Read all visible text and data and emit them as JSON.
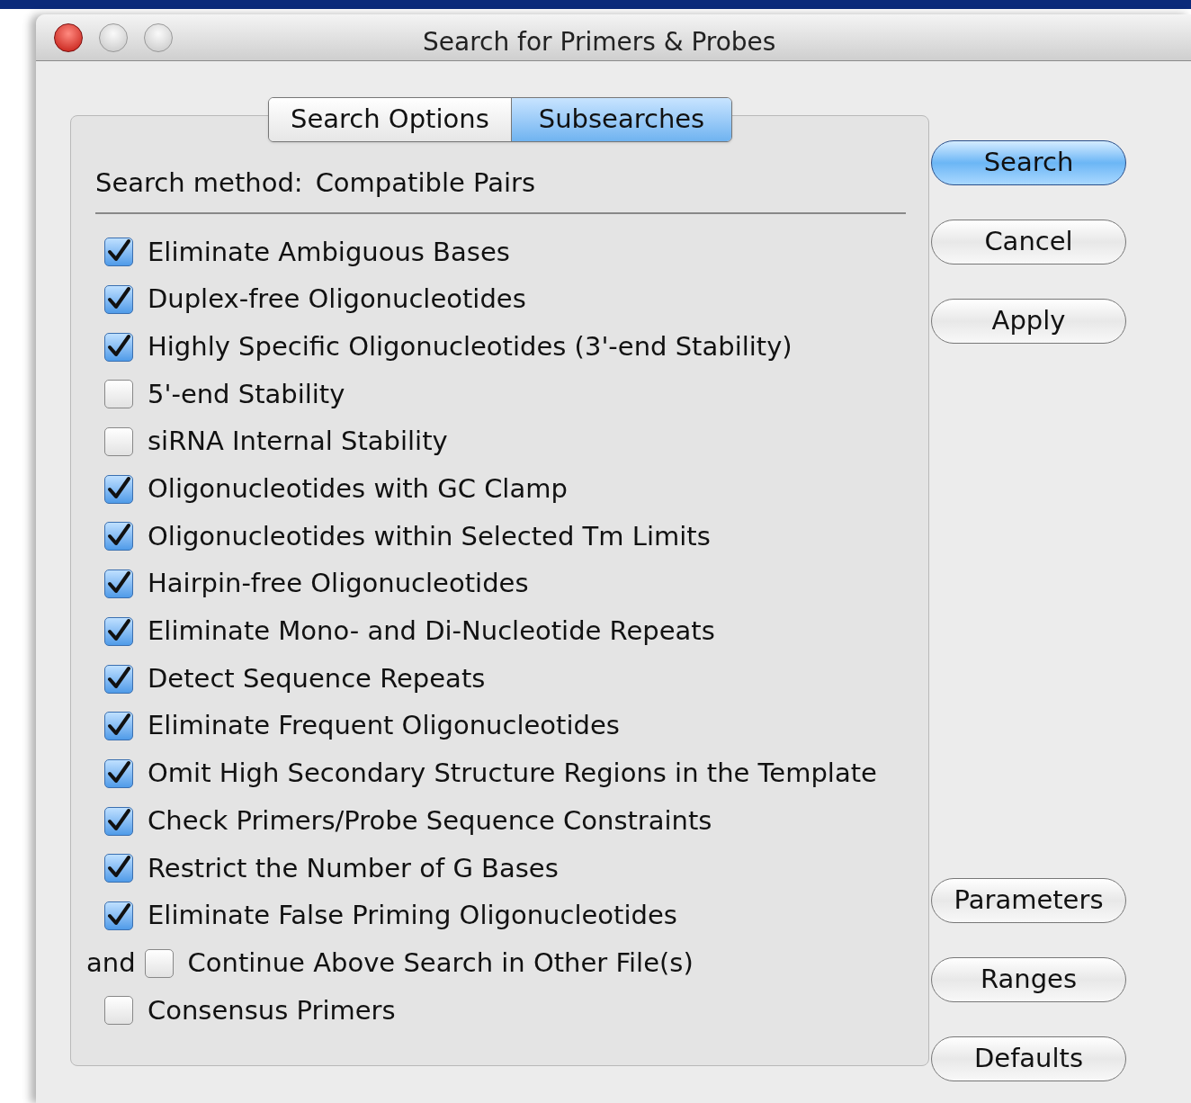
{
  "window": {
    "title": "Search for Primers & Probes"
  },
  "tabs": [
    {
      "label": "Search Options",
      "selected": false
    },
    {
      "label": "Subsearches",
      "selected": true
    }
  ],
  "search_method": {
    "label": "Search method:",
    "value": "Compatible Pairs"
  },
  "options": [
    {
      "kind": "checkbox",
      "label": "Eliminate Ambiguous Bases",
      "checked": true
    },
    {
      "kind": "checkbox",
      "label": "Duplex-free Oligonucleotides",
      "checked": true
    },
    {
      "kind": "checkbox",
      "label": "Highly Specific Oligonucleotides (3'-end Stability)",
      "checked": true
    },
    {
      "kind": "checkbox",
      "label": "5'-end Stability",
      "checked": false
    },
    {
      "kind": "checkbox",
      "label": "siRNA Internal Stability",
      "checked": false
    },
    {
      "kind": "checkbox",
      "label": "Oligonucleotides with GC Clamp",
      "checked": true
    },
    {
      "kind": "checkbox",
      "label": "Oligonucleotides within Selected Tm Limits",
      "checked": true
    },
    {
      "kind": "checkbox",
      "label": "Hairpin-free Oligonucleotides",
      "checked": true
    },
    {
      "kind": "checkbox",
      "label": "Eliminate Mono- and Di-Nucleotide Repeats",
      "checked": true
    },
    {
      "kind": "checkbox",
      "label": "Detect Sequence Repeats",
      "checked": true
    },
    {
      "kind": "checkbox",
      "label": "Eliminate Frequent Oligonucleotides",
      "checked": true
    },
    {
      "kind": "checkbox",
      "label": "Omit High Secondary Structure Regions in the Template",
      "checked": true
    },
    {
      "kind": "checkbox",
      "label": "Check Primers/Probe Sequence Constraints",
      "checked": true
    },
    {
      "kind": "checkbox",
      "label": "Restrict the Number of G Bases",
      "checked": true
    },
    {
      "kind": "checkbox",
      "label": "Eliminate False Priming Oligonucleotides",
      "checked": true
    },
    {
      "kind": "conjunction",
      "prefix": "and",
      "label": "Continue Above Search in Other File(s)",
      "checked": false
    },
    {
      "kind": "checkbox",
      "label": "Consensus Primers",
      "checked": false
    }
  ],
  "buttons_top": [
    {
      "label": "Search",
      "default": true
    },
    {
      "label": "Cancel",
      "default": false
    },
    {
      "label": "Apply",
      "default": false
    }
  ],
  "buttons_bottom": [
    {
      "label": "Parameters",
      "default": false
    },
    {
      "label": "Ranges",
      "default": false
    },
    {
      "label": "Defaults",
      "default": false
    }
  ]
}
